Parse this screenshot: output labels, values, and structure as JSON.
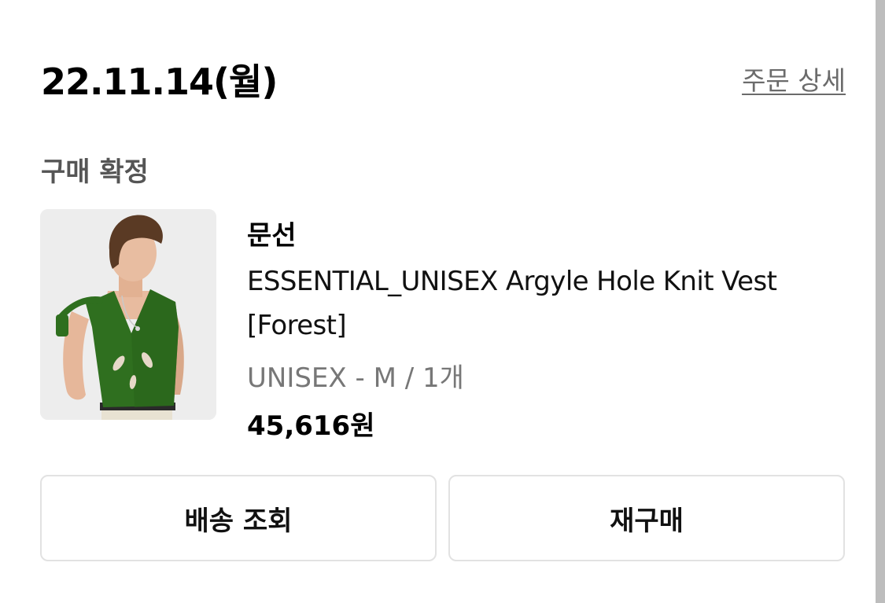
{
  "order": {
    "date": "22.11.14(월)",
    "detail_link": "주문 상세",
    "status": "구매 확정"
  },
  "product": {
    "image_alt": "Model wearing green argyle hole knit vest",
    "brand": "문선",
    "name": "ESSENTIAL_UNISEX Argyle Hole Knit Vest [Forest]",
    "option": "UNISEX - M / 1개",
    "price": "45,616원"
  },
  "actions": {
    "track_delivery": "배송 조회",
    "reorder": "재구매"
  },
  "colors": {
    "vest": "#2f6f1f",
    "link": "#6b6b6b",
    "status": "#555555",
    "option": "#777777",
    "button_border": "#e2e2e2"
  }
}
